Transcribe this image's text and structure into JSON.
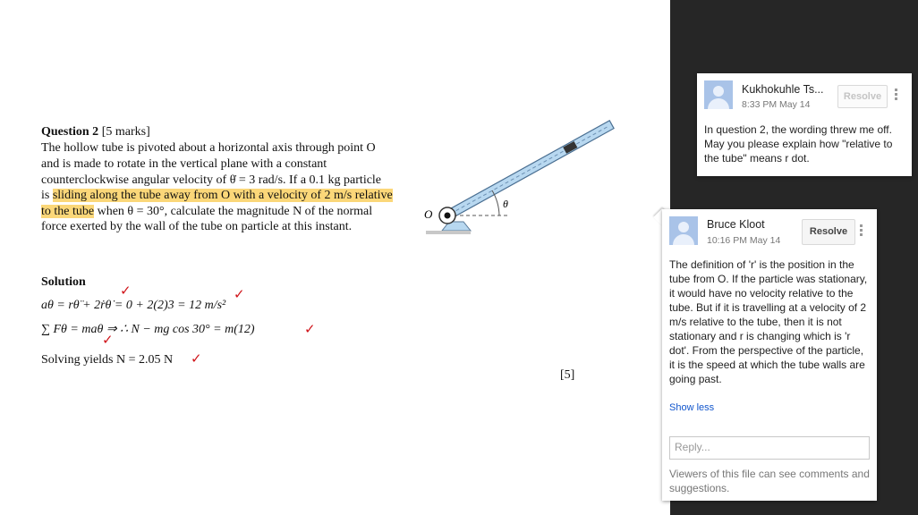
{
  "document": {
    "question_title": "Question 2",
    "question_marks": "[5 marks]",
    "lines": [
      "The hollow tube is pivoted about a horizontal axis through point O",
      "and is made to rotate in the vertical plane with a constant",
      "counterclockwise angular velocity of θ̇ = 3 rad/s. If a 0.1 kg particle"
    ],
    "line4_pre": "is ",
    "line4_hl": "sliding along the tube away from O with a velocity of 2 m/s relative",
    "line5_hl": "to the tube",
    "line5_post": " when θ = 30°, calculate the magnitude N of the normal",
    "line6": "force exerted by the wall of the tube on particle at this instant.",
    "solution_label": "Solution",
    "eq1": "aθ = rθ̈ + 2ṙθ̇ = 0 + 2(2)3 = 12 m/s²",
    "eq2": "∑ Fθ = maθ   ⇒ ∴   N − mg cos 30° = m(12)",
    "eq3": "Solving yields N = 2.05 N",
    "marks_total": "[5]",
    "diagram": {
      "label_o": "O",
      "label_theta": "θ"
    }
  },
  "comments": [
    {
      "author": "Kukhokuhle Ts...",
      "time": "8:33 PM May 14",
      "resolve_label": "Resolve",
      "text": "In question 2, the wording threw me off. May you please explain how \"relative to the tube\" means r dot."
    },
    {
      "author": "Bruce Kloot",
      "time": "10:16 PM May 14",
      "resolve_label": "Resolve",
      "text": "The definition of 'r' is the position in the tube from O. If the particle was stationary, it would have no velocity relative to the tube. But if it is travelling at a velocity of 2 m/s relative to the tube, then it is not stationary and r is changing which is 'r dot'. From the perspective of the particle, it is the speed at which the tube walls are going past.",
      "show_less": "Show less",
      "reply_placeholder": "Reply...",
      "viewers_note": "Viewers of this file can see comments and suggestions."
    }
  ],
  "colors": {
    "highlight": "#fbd779",
    "tick": "#d0141a",
    "tube": "#b8d8f0",
    "sidebar_bg": "#262626",
    "link": "#1155cc"
  }
}
